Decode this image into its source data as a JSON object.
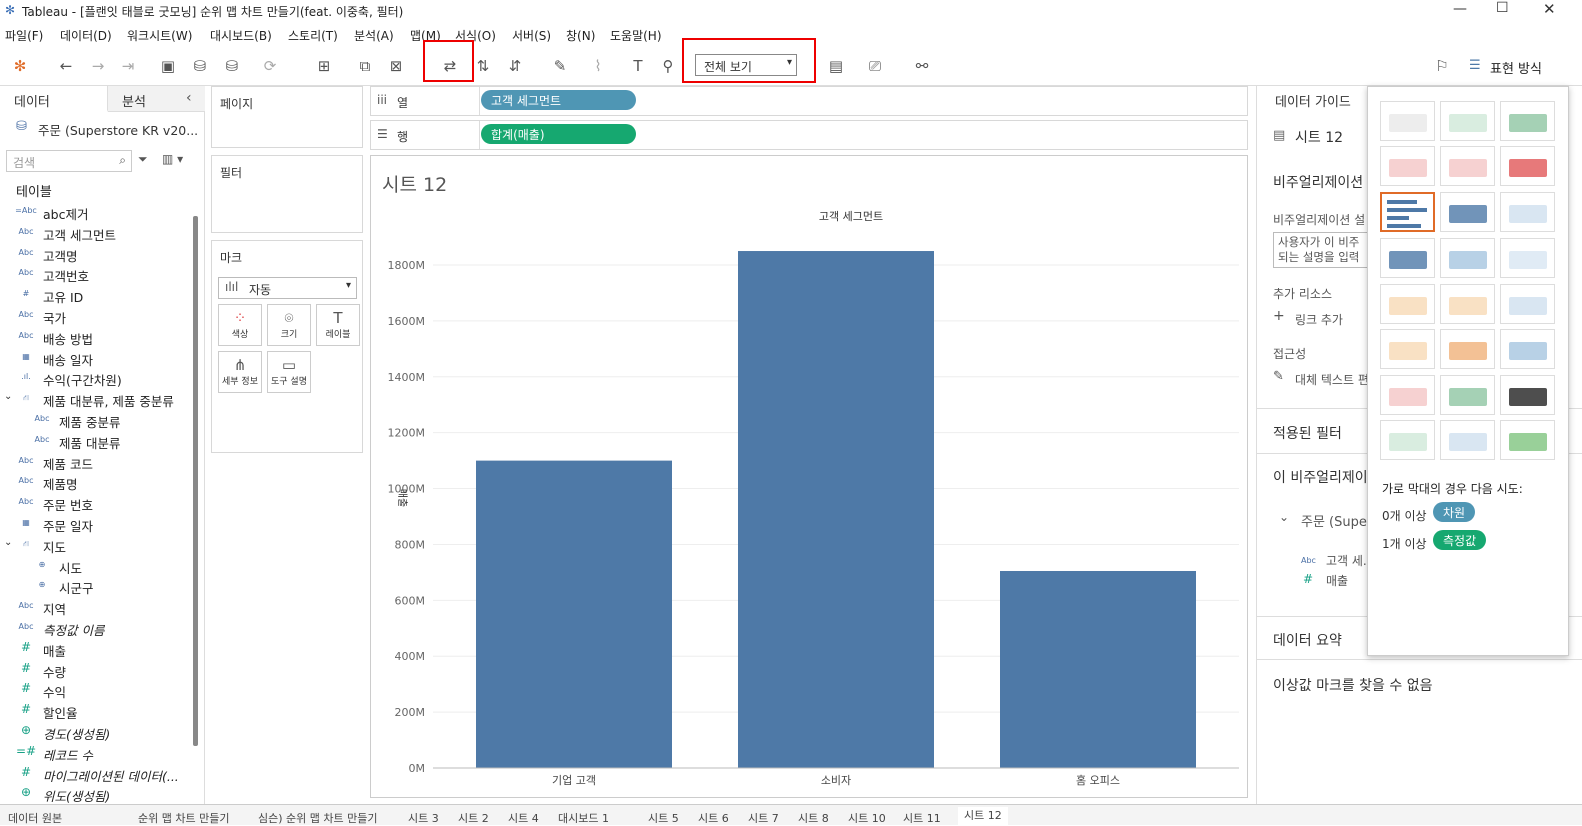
{
  "window": {
    "title": "Tableau - [플랜잇 태블로 굿모닝] 순위 맵 차트 만들기(feat. 이중축, 필터)"
  },
  "menu": [
    "파일(F)",
    "데이터(D)",
    "워크시트(W)",
    "대시보드(B)",
    "스토리(T)",
    "분석(A)",
    "맵(M)",
    "서식(O)",
    "서버(S)",
    "창(N)",
    "도움말(H)"
  ],
  "toolbar": {
    "fit_value": "전체 보기",
    "showme_label": "표현 방식"
  },
  "left": {
    "tabs": [
      "데이터",
      "분석"
    ],
    "datasource": "주문 (Superstore KR v20...",
    "search_placeholder": "검색",
    "tables_label": "테이블",
    "fields": [
      {
        "icon": "=Abc",
        "label": "abc제거",
        "indent": 0
      },
      {
        "icon": "Abc",
        "label": "고객 세그먼트",
        "indent": 0
      },
      {
        "icon": "Abc",
        "label": "고객명",
        "indent": 0
      },
      {
        "icon": "Abc",
        "label": "고객번호",
        "indent": 0
      },
      {
        "icon": "#",
        "label": "고유 ID",
        "indent": 0
      },
      {
        "icon": "Abc",
        "label": "국가",
        "indent": 0
      },
      {
        "icon": "Abc",
        "label": "배송 방법",
        "indent": 0
      },
      {
        "icon": "▦",
        "label": "배송 일자",
        "indent": 0
      },
      {
        "icon": ".ıl.",
        "label": "수익(구간차원)",
        "indent": 0
      },
      {
        "icon": "⛙",
        "label": "제품 대분류, 제품 중분류",
        "indent": 0
      },
      {
        "icon": "Abc",
        "label": "제품 중분류",
        "indent": 1
      },
      {
        "icon": "Abc",
        "label": "제품 대분류",
        "indent": 1
      },
      {
        "icon": "Abc",
        "label": "제품 코드",
        "indent": 0
      },
      {
        "icon": "Abc",
        "label": "제품명",
        "indent": 0
      },
      {
        "icon": "Abc",
        "label": "주문 번호",
        "indent": 0
      },
      {
        "icon": "▦",
        "label": "주문 일자",
        "indent": 0
      },
      {
        "icon": "⛙",
        "label": "지도",
        "indent": 0
      },
      {
        "icon": "⊕",
        "label": "시도",
        "indent": 1
      },
      {
        "icon": "⊕",
        "label": "시군구",
        "indent": 1
      },
      {
        "icon": "Abc",
        "label": "지역",
        "indent": 0
      },
      {
        "icon": "Abc",
        "label": "측정값 이름",
        "indent": 0
      },
      {
        "icon": "#",
        "label": "매출",
        "indent": 0
      },
      {
        "icon": "#",
        "label": "수량",
        "indent": 0
      },
      {
        "icon": "#",
        "label": "수익",
        "indent": 0
      },
      {
        "icon": "#",
        "label": "할인율",
        "indent": 0
      },
      {
        "icon": "⊕",
        "label": "경도(생성됨)",
        "indent": 0
      },
      {
        "icon": "=#",
        "label": "레코드 수",
        "indent": 0
      },
      {
        "icon": "#",
        "label": "마이그레이션된 데이터(...",
        "indent": 0
      },
      {
        "icon": "⊕",
        "label": "위도(생성됨)",
        "indent": 0
      }
    ]
  },
  "shelves": {
    "pages": "페이지",
    "filters": "필터",
    "marks": "마크",
    "columns_label": "열",
    "rows_label": "행",
    "columns_pill": "고객 세그먼트",
    "rows_pill": "합계(매출)",
    "mark_type": "자동",
    "mark_buttons": [
      "색상",
      "크기",
      "레이블",
      "세부 정보",
      "도구 설명"
    ]
  },
  "sheet": {
    "title": "시트 12"
  },
  "chart_data": {
    "type": "bar",
    "title": "고객 세그먼트",
    "ylabel": "매출",
    "categories": [
      "기업 고객",
      "소비자",
      "홈 오피스"
    ],
    "values": [
      1100,
      1850,
      705
    ],
    "yticks": [
      "0M",
      "200M",
      "400M",
      "600M",
      "800M",
      "1000M",
      "1200M",
      "1400M",
      "1600M",
      "1800M"
    ],
    "ylim": [
      0,
      1800
    ],
    "bar_color": "#4e79a7"
  },
  "right": {
    "tab": "데이터 가이드",
    "sheet": "시트 12",
    "viz_desc": "비주얼리제이션",
    "viz_desc2": "비주얼리제이션 설",
    "desc_placeholder": "사용자가 이 비주 되는 설명을 입력",
    "resources": "추가 리소스",
    "add_link": "링크 추가",
    "access": "접근성",
    "alt_text": "대체 텍스트 편",
    "filters": "적용된 필터",
    "viz_data": "이 비주얼리제이",
    "ds": "주문 (Supe",
    "f1": "고객 세...",
    "f2": "매출",
    "summary": "데이터 요약",
    "outlier": "이상값 마크를 찾을 수 없음"
  },
  "showme": {
    "hint": "가로 막대의 경우 다음 시도:",
    "dim_req": "0개 이상",
    "dim_pill": "차원",
    "mea_req": "1개 이상",
    "mea_pill": "측정값"
  },
  "bottom_tabs": [
    "데이터 원본",
    "순위 맵 차트 만들기",
    "심슨) 순위 맵 차트 만들기",
    "시트 3",
    "시트 2",
    "시트 4",
    "대시보드 1",
    "시트 5",
    "시트 6",
    "시트 7",
    "시트 8",
    "시트 10",
    "시트 11",
    "시트 12"
  ]
}
